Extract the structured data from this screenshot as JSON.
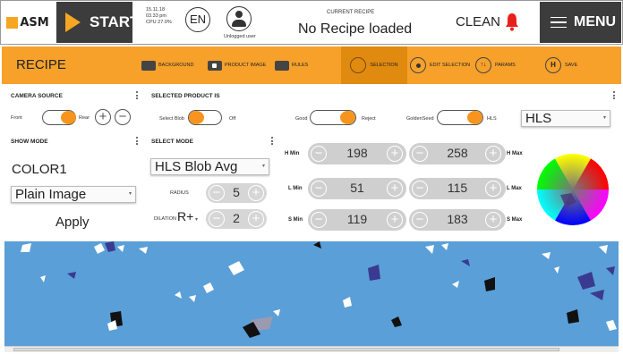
{
  "header": {
    "logo_text": "ASM",
    "start_label": "START",
    "date": "15.11.18",
    "time": "03.33 pm",
    "cpu": "CPU 27.0%",
    "language": "EN",
    "user_label": "Unlogged user",
    "current_recipe_label": "CURRENT RECIPE",
    "current_recipe_value": "No Recipe loaded",
    "clean_label": "CLEAN",
    "menu_label": "MENU"
  },
  "recipe_bar": {
    "title": "RECIPE",
    "items": [
      {
        "label": "BACKGROUND",
        "icon": "monitor-icon"
      },
      {
        "label": "PRODUCT IMAGE",
        "icon": "image-icon"
      },
      {
        "label": "RULES",
        "icon": "rules-icon"
      },
      {
        "label": "SELECTION",
        "icon": "selection-icon"
      },
      {
        "label": "EDIT SELECTION",
        "icon": "edit-selection-icon"
      },
      {
        "label": "PARAMS",
        "icon": "params-icon"
      },
      {
        "label": "SAVE",
        "icon": "save-icon"
      }
    ],
    "active": "SELECTION"
  },
  "camera_source": {
    "title": "CAMERA SOURCE",
    "left_label": "Front",
    "right_label": "Rear",
    "value": "Front"
  },
  "selected_product": {
    "title": "SELECTED PRODUCT IS",
    "blob_left": "Select Blob",
    "blob_right": "Off",
    "good_left": "Good",
    "good_right": "Reject",
    "seed_left": "GoldenSeed",
    "seed_right": "HLS",
    "color_space": "HLS"
  },
  "show_mode": {
    "title": "SHOW MODE",
    "value": "COLOR1",
    "image_select": "Plain Image",
    "apply_label": "Apply"
  },
  "select_mode": {
    "title": "SELECT MODE",
    "mode": "HLS Blob Avg",
    "radius_label": "RADIUS",
    "radius_value": "5",
    "dilation_label": "DILATION",
    "dilation_mode": "R+",
    "dilation_value": "2"
  },
  "hls_ranges": {
    "h_min_label": "H Min",
    "h_min": "198",
    "h_max_label": "H Max",
    "h_max": "258",
    "l_min_label": "L Min",
    "l_min": "51",
    "l_max_label": "L Max",
    "l_max": "115",
    "s_min_label": "S Min",
    "s_min": "119",
    "s_max_label": "S Max",
    "s_max": "183"
  },
  "colors": {
    "accent": "#f7a12b",
    "accent_active": "#e08a10",
    "dark": "#3c3c3c",
    "toggle": "#f7941d",
    "bell": "#e8201b",
    "image_bg": "#5a9fd8"
  }
}
